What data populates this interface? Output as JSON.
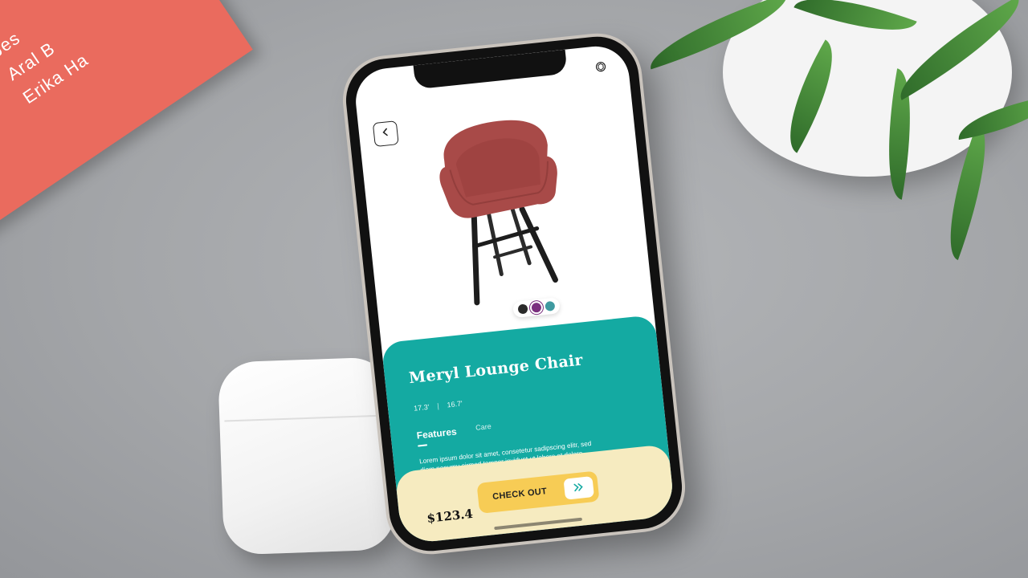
{
  "product": {
    "name": "Meryl Lounge Chair",
    "dims": {
      "width": "17.3'",
      "separator": "|",
      "depth": "16.7'"
    },
    "colors": [
      "#2a2a2a",
      "#7a2f7e",
      "#3f9aa0"
    ],
    "selected_color_index": 1,
    "tabs": [
      {
        "label": "Features",
        "active": true
      },
      {
        "label": "Care",
        "active": false
      }
    ],
    "description": "Lorem ipsum dolor sit amet, consetetur sadipscing elitr, sed diam nonumy eirmod tempor invidunt ut labore et dolore magna aliquyam erat, sed diam voluptua. At vero eos et accusam et justo duo dolores et ea rebum. Stet clita kasd guber",
    "price": "$123.4",
    "checkout_label": "CHECK OUT"
  },
  "icons": {
    "back": "chevron-left-icon",
    "ar": "ar-view-icon",
    "checkout_arrow": "double-chevron-right-icon"
  },
  "accent_colors": {
    "teal": "#14aaa2",
    "cream": "#f6ebc0",
    "yellow": "#f7cc55",
    "chair": "#a84a48"
  },
  "book_text": [
    "Jes",
    "Aral B",
    "Erika Ha"
  ]
}
